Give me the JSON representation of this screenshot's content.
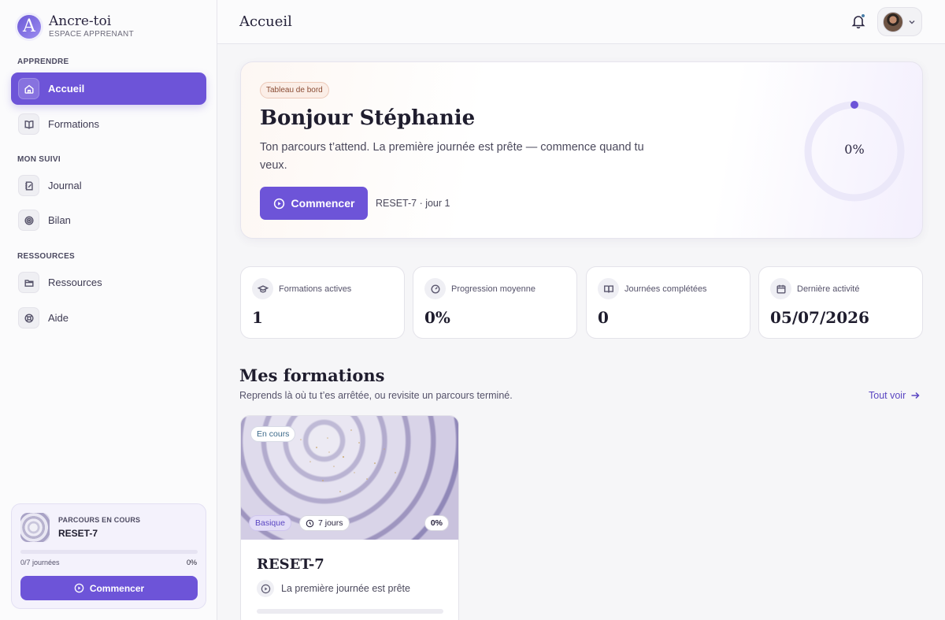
{
  "brand": {
    "name": "Ancre-toi",
    "subtitle": "ESPACE APPRENANT",
    "logo_letter": "A"
  },
  "sidebar": {
    "sections": [
      {
        "label": "APPRENDRE"
      },
      {
        "label": "MON SUIVI"
      },
      {
        "label": "RESSOURCES"
      }
    ],
    "items": [
      {
        "label": "Accueil",
        "icon": "home-icon",
        "active": true
      },
      {
        "label": "Formations",
        "icon": "book-icon"
      },
      {
        "label": "Journal",
        "icon": "journal-icon"
      },
      {
        "label": "Bilan",
        "icon": "target-icon"
      },
      {
        "label": "Ressources",
        "icon": "folder-icon"
      },
      {
        "label": "Aide",
        "icon": "lifebuoy-icon"
      }
    ],
    "current_course": {
      "kicker": "PARCOURS EN COURS",
      "title": "RESET-7",
      "progress_text": "0/7 journées",
      "progress_pct_label": "0%",
      "progress": 0,
      "button_label": "Commencer"
    }
  },
  "header": {
    "title": "Accueil",
    "notification_dot": true
  },
  "hero": {
    "badge": "Tableau de bord",
    "title": "Bonjour Stéphanie",
    "text": "Ton parcours t’attend. La première journée est prête — commence quand tu veux.",
    "button_label": "Commencer",
    "meta": "RESET-7 · jour 1",
    "progress_label": "0%",
    "progress": 0
  },
  "stats": [
    {
      "label": "Formations actives",
      "value": "1",
      "icon": "graduation-cap-icon"
    },
    {
      "label": "Progression moyenne",
      "value": "0%",
      "icon": "gauge-icon"
    },
    {
      "label": "Journées complétées",
      "value": "0",
      "icon": "open-book-icon"
    },
    {
      "label": "Dernière activité",
      "value": "05/07/2026",
      "icon": "calendar-icon"
    }
  ],
  "formations": {
    "title": "Mes formations",
    "subtitle": "Reprends là où tu t’es arrêtée, ou revisite un parcours terminé.",
    "see_all": "Tout voir",
    "cards": [
      {
        "status": "En cours",
        "level": "Basique",
        "duration": "7 jours",
        "progress_label": "0%",
        "progress": 0,
        "title": "RESET-7",
        "next": "La première journée est prête"
      }
    ]
  },
  "colors": {
    "accent": "#6d54d8",
    "badge_bg": "#fbeee7",
    "link": "#5a46c2"
  }
}
